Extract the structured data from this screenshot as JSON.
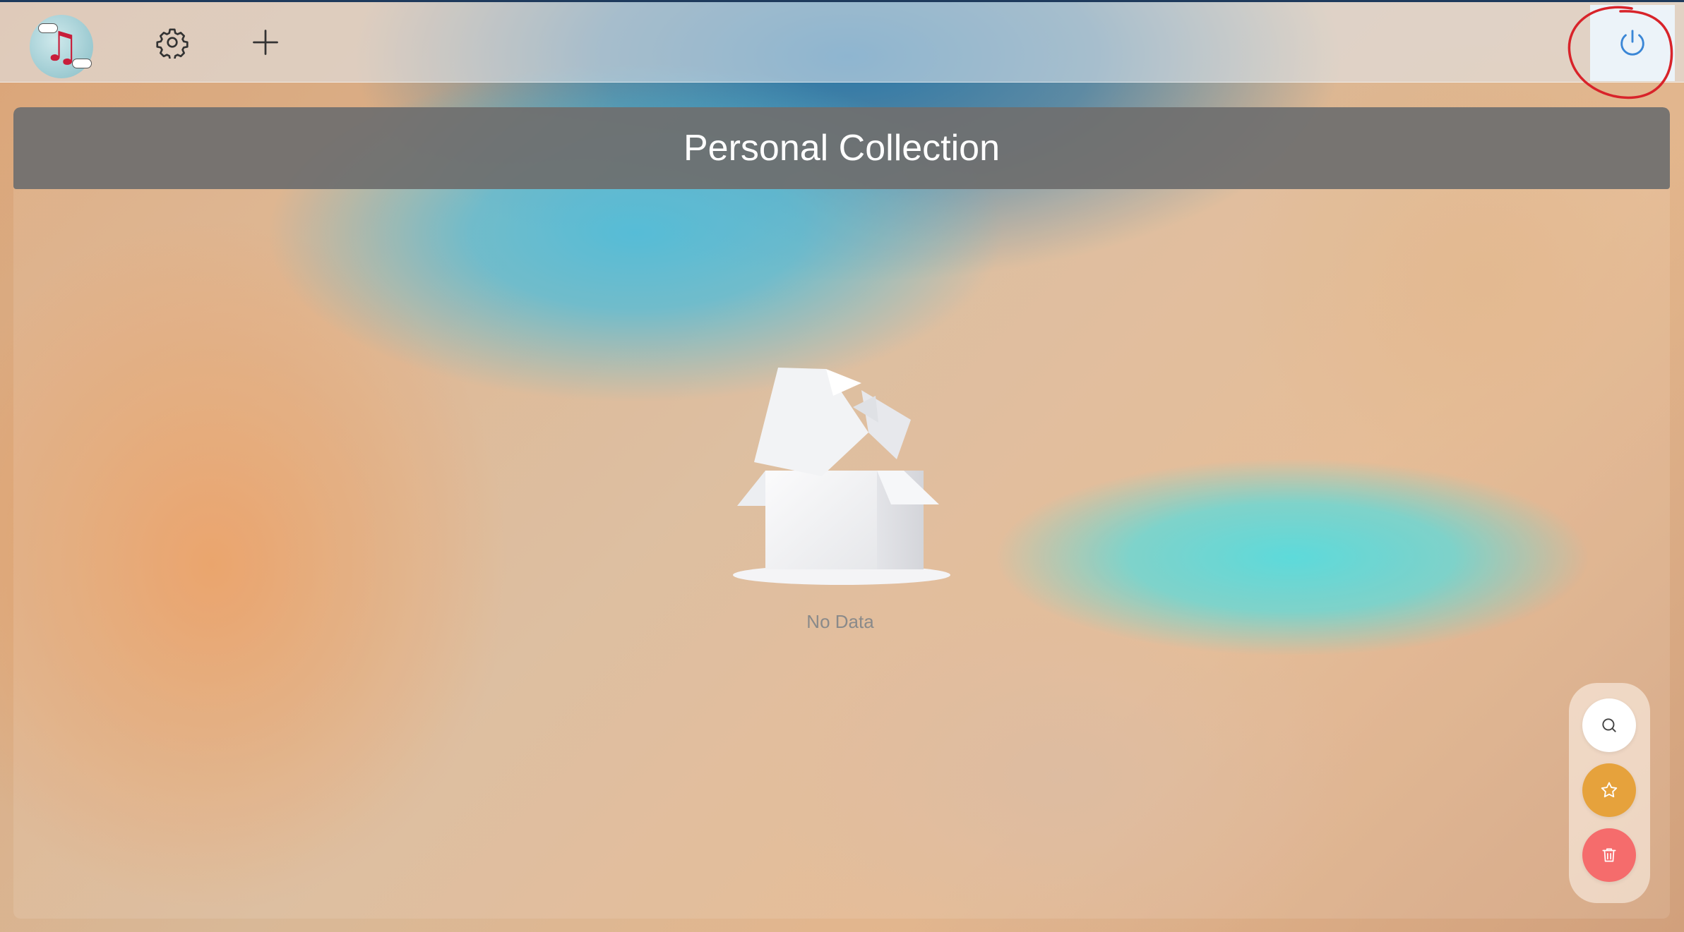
{
  "header": {
    "logo_icon": "music-note-logo",
    "settings_icon": "gear-icon",
    "add_icon": "plus-icon",
    "power_icon": "power-icon",
    "colors": {
      "annotation_circle": "#d8232a",
      "bar_top_border": "#1e3a5c"
    }
  },
  "panel": {
    "title": "Personal Collection",
    "header_color": "#6e6e6e"
  },
  "empty_state": {
    "icon": "empty-box-icon",
    "text": "No Data"
  },
  "fab": {
    "items": [
      {
        "icon": "search-icon",
        "color": "#ffffff"
      },
      {
        "icon": "star-icon",
        "color": "#e6a23c"
      },
      {
        "icon": "trash-icon",
        "color": "#f56c6c"
      }
    ]
  }
}
